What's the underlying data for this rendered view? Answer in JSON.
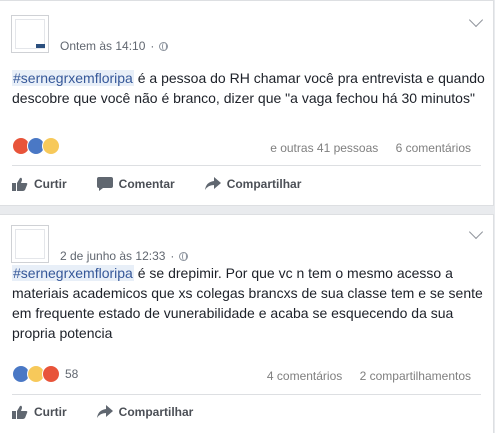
{
  "posts": [
    {
      "timestamp": "Ontem às 14:10",
      "separator": "·",
      "hashtag": "#sernegrxemfloripa",
      "text": " é a pessoa do RH chamar você pra entrevista e quando descobre que você não é branco, dizer que \"a vaga fechou há 30 minutos\"",
      "reaction_count": "",
      "reactions_text": "e outras 41 pessoas",
      "comments_text": "6 comentários",
      "shares_text": "",
      "actions": {
        "like": "Curtir",
        "comment": "Comentar",
        "share": "Compartilhar"
      },
      "reaction_icons": [
        "angry-icon",
        "like-icon",
        "sad-icon"
      ]
    },
    {
      "timestamp": "2 de junho às 12:33",
      "separator": "·",
      "hashtag": "#sernegrxemfloripa",
      "text": " é se drepimir. Por que vc n tem o mesmo acesso a materiais academicos que xs colegas brancxs de sua classe tem e se sente em frequente estado de vunerabilidade e acaba se esquecendo da sua propria potencia",
      "reaction_count": "58",
      "comments_text": "4 comentários",
      "shares_text": "2 compartilhamentos",
      "actions": {
        "like": "Curtir",
        "share": "Compartilhar"
      },
      "reaction_icons": [
        "like-icon",
        "sad-icon",
        "angry-icon"
      ]
    }
  ],
  "colors": {
    "page_bg": "#e9ebee",
    "card_bg": "#ffffff",
    "link": "#365899",
    "hashtag_bg": "#e8eff8",
    "muted": "#616770"
  }
}
